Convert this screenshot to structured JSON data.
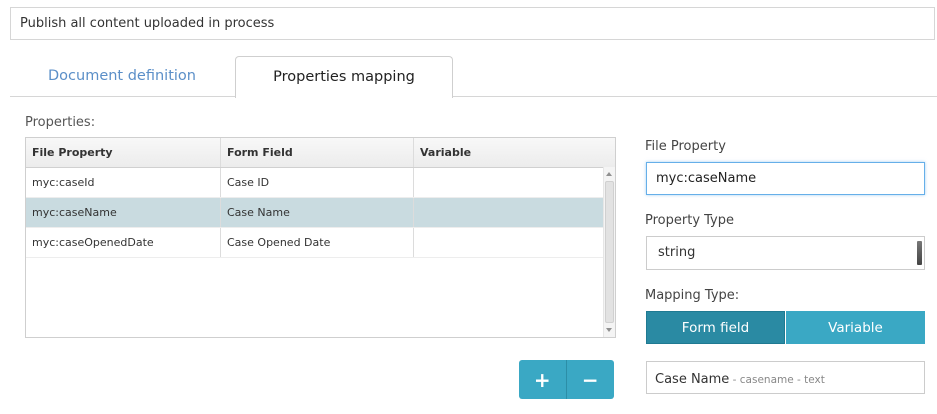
{
  "header": {
    "description": "Publish all content uploaded in process"
  },
  "tabs": [
    {
      "label": "Document definition",
      "active": false
    },
    {
      "label": "Properties mapping",
      "active": true
    }
  ],
  "properties": {
    "label": "Properties:",
    "columns": [
      "File Property",
      "Form Field",
      "Variable"
    ],
    "rows": [
      {
        "file_property": "myc:caseId",
        "form_field": "Case ID",
        "variable": "",
        "selected": false
      },
      {
        "file_property": "myc:caseName",
        "form_field": "Case Name",
        "variable": "",
        "selected": true
      },
      {
        "file_property": "myc:caseOpenedDate",
        "form_field": "Case Opened Date",
        "variable": "",
        "selected": false
      }
    ],
    "add_label": "+",
    "remove_label": "−"
  },
  "details": {
    "file_property_label": "File Property",
    "file_property_value": "myc:caseName",
    "property_type_label": "Property Type",
    "property_type_value": "string",
    "mapping_type_label": "Mapping Type:",
    "mapping_options": [
      {
        "label": "Form field",
        "active": true
      },
      {
        "label": "Variable",
        "active": false
      }
    ],
    "mapped_field": {
      "name": "Case Name",
      "meta": " - casename - text"
    }
  },
  "colors": {
    "accent": "#3aa8c4",
    "accent_active": "#2a8aa3",
    "tab_inactive_text": "#5b8fc8",
    "selected_row": "#c9dbe0",
    "focus_border": "#66afe9"
  }
}
